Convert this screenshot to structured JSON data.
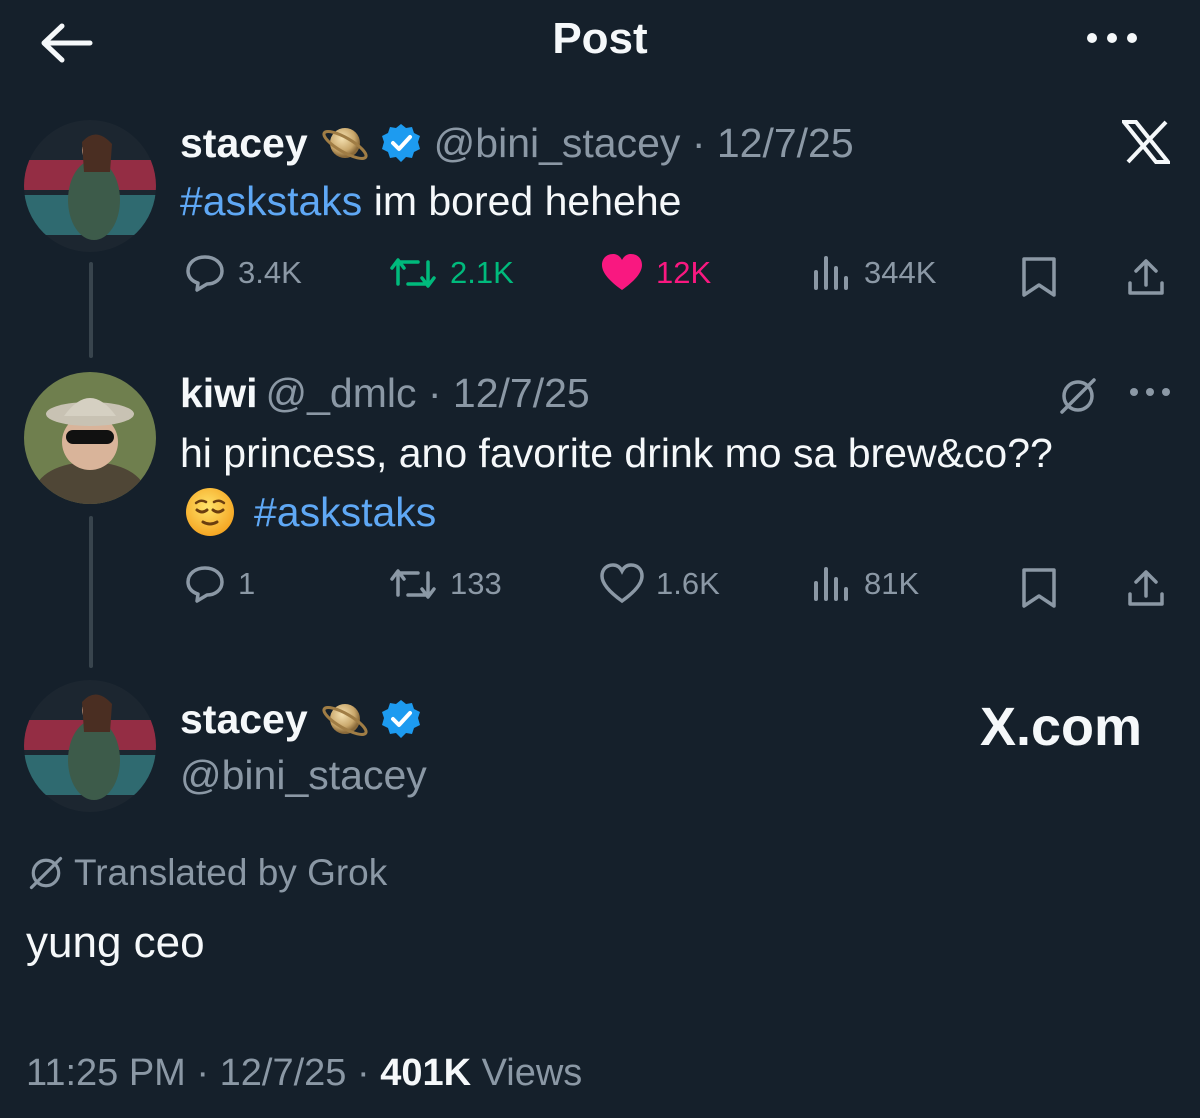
{
  "header": {
    "title": "Post"
  },
  "quoted_tweet": {
    "name": "stacey",
    "handle": "@bini_stacey",
    "date": "12/7/25",
    "hashtag": "#askstaks",
    "text": " im bored hehehe",
    "stats": {
      "replies": "3.4K",
      "reposts": "2.1K",
      "likes": "12K",
      "views": "344K"
    }
  },
  "question_tweet": {
    "name": "kiwi",
    "handle": "@_dmlc",
    "date": "12/7/25",
    "text": "hi princess, ano favorite drink mo sa brew&co??",
    "hashtag": "#askstaks",
    "stats": {
      "replies": "1",
      "reposts": "133",
      "likes": "1.6K",
      "views": "81K"
    }
  },
  "main_post": {
    "name": "stacey",
    "handle": "@bini_stacey",
    "watermark": "X.com",
    "translated_label": "Translated by Grok",
    "text": "yung ceo",
    "time": "11:25 PM",
    "date": "12/7/25",
    "views_count": "401K",
    "views_label": "Views"
  },
  "colors": {
    "background": "#15202b",
    "text": "#f5f8fa",
    "muted": "#8b98a5",
    "link": "#5fa8f5",
    "repost_active": "#00ba7c",
    "like_active": "#f91880",
    "verified": "#1d9bf0"
  },
  "icons": [
    "back-arrow-icon",
    "more-icon",
    "x-logo-icon",
    "verified-icon",
    "saturn-emoji",
    "reply-icon",
    "repost-icon",
    "heart-icon",
    "views-icon",
    "bookmark-icon",
    "share-icon",
    "grok-icon",
    "relieved-emoji"
  ]
}
